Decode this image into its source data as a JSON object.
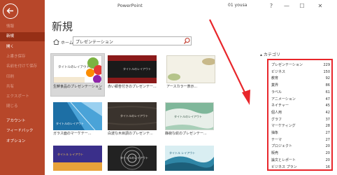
{
  "window": {
    "app_title": "PowerPoint",
    "user": "01 yousa",
    "help": "?",
    "minimize": "—",
    "maximize": "☐",
    "close": "✕"
  },
  "sidebar": {
    "items": [
      {
        "label": "情報"
      },
      {
        "label": "新規"
      },
      {
        "label": "開く"
      },
      {
        "label": "上書き保存"
      },
      {
        "label": "名前を付けて保存"
      },
      {
        "label": "印刷"
      },
      {
        "label": "共有"
      },
      {
        "label": "エクスポート"
      },
      {
        "label": "閉じる"
      },
      {
        "label": "アカウント"
      },
      {
        "label": "フィードバック"
      },
      {
        "label": "オプション"
      }
    ]
  },
  "main": {
    "heading": "新規",
    "home_label": "ホーム",
    "search_value": "プレゼンテーション"
  },
  "templates": [
    {
      "caption": "生鮮食品のプレゼンテーション",
      "thumb_text": "タイトルのレイアウト"
    },
    {
      "caption": "赤い銀杏付きのプレゼンテー...",
      "thumb_text": "タイトルのレイアウト"
    },
    {
      "caption": "アースカラー表示...",
      "thumb_text": ""
    },
    {
      "caption": "ガラス面のマーケテー...",
      "thumb_text": "タイトルのレイアウト"
    },
    {
      "caption": "白波な木目調のプレゼンテ...",
      "thumb_text": "タイトルのレイアウト"
    },
    {
      "caption": "静寂な紋のプレゼンテー...",
      "thumb_text": "タイトルのレイアウト"
    },
    {
      "caption": "",
      "thumb_text": "タイトル レイアウト"
    },
    {
      "caption": "",
      "thumb_text": "タイトルのレイアウト"
    },
    {
      "caption": "",
      "thumb_text": "タイトル レイアウト"
    }
  ],
  "categories": {
    "header": "カテゴリ",
    "items": [
      {
        "name": "プレゼンテーション",
        "count": "229"
      },
      {
        "name": "ビジネス",
        "count": "150"
      },
      {
        "name": "教育",
        "count": "92"
      },
      {
        "name": "業界",
        "count": "86"
      },
      {
        "name": "ラベル",
        "count": "61"
      },
      {
        "name": "アニメーション",
        "count": "47"
      },
      {
        "name": "ネイチャー",
        "count": "45"
      },
      {
        "name": "個人用",
        "count": "42"
      },
      {
        "name": "グラフ",
        "count": "37"
      },
      {
        "name": "マーケティング",
        "count": "28"
      },
      {
        "name": "抽象",
        "count": "27"
      },
      {
        "name": "テーマ",
        "count": "27"
      },
      {
        "name": "プロジェクト",
        "count": "20"
      },
      {
        "name": "販売",
        "count": "20"
      },
      {
        "name": "論文とレポート",
        "count": "20"
      },
      {
        "name": "ビジネス プラン",
        "count": "16"
      }
    ]
  },
  "colors": {
    "sidebar": "#b7472a",
    "sidebar_active": "#962f16",
    "highlight_border": "#e8262b",
    "arrow": "#e8262b"
  },
  "icons": {
    "back": "back-arrow-icon",
    "home": "home-icon",
    "search": "search-icon",
    "pin": "pin-icon",
    "collapse": "chevron-up-icon"
  }
}
